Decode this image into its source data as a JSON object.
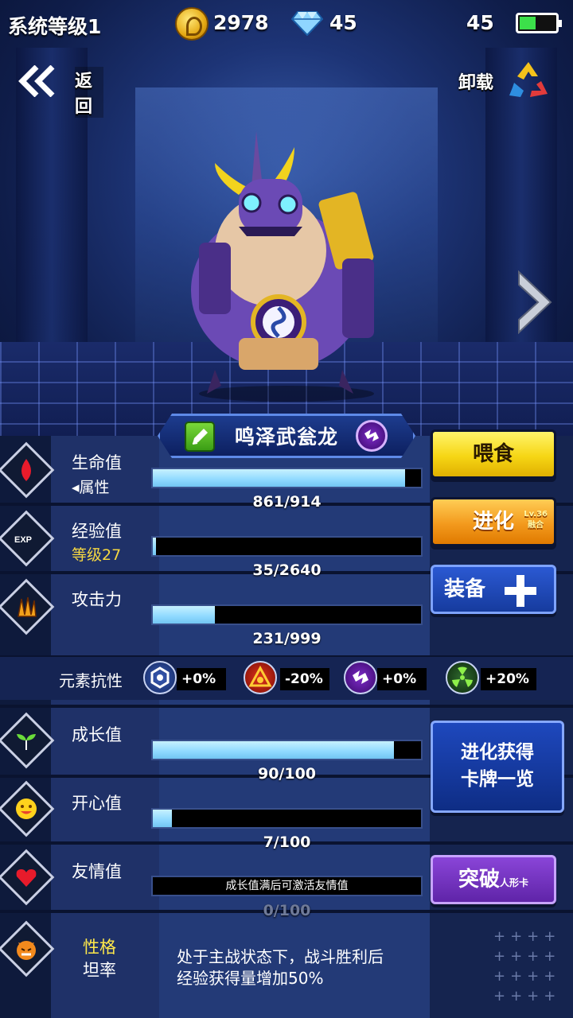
{
  "status_bar": {
    "system_level": "系统等级1",
    "coins": "2978",
    "gems": "45",
    "battery_text": "45",
    "battery_level": 0.45
  },
  "nav": {
    "back_label": "返回",
    "unload_label": "卸载"
  },
  "monster": {
    "name": "鸣泽武瓮龙"
  },
  "stats": {
    "hp": {
      "label": "生命值",
      "sub": "◂属性",
      "current": 861,
      "max": 914,
      "text": "861/914"
    },
    "exp": {
      "label": "经验值",
      "sub": "等级27",
      "current": 35,
      "max": 2640,
      "text": "35/2640"
    },
    "attack": {
      "label": "攻击力",
      "current": 231,
      "max": 999,
      "text": "231/999"
    },
    "growth": {
      "label": "成长值",
      "current": 90,
      "max": 100,
      "text": "90/100"
    },
    "happiness": {
      "label": "开心值",
      "current": 7,
      "max": 100,
      "text": "7/100"
    },
    "friendship": {
      "label": "友情值",
      "current": 0,
      "max": 100,
      "text": "0/100",
      "lock_message": "成长值满后可激活友情值"
    }
  },
  "resistance": {
    "label": "元素抗性",
    "items": [
      {
        "icon": "hex-ring-icon",
        "value": "+0%"
      },
      {
        "icon": "fire-triangle-icon",
        "value": "-20%"
      },
      {
        "icon": "lightning-icon",
        "value": "+0%"
      },
      {
        "icon": "radiation-icon",
        "value": "+20%"
      }
    ]
  },
  "buttons": {
    "feed": "喂食",
    "evolve": "进化",
    "evolve_tag_1": "Lv.36",
    "evolve_tag_2": "融合",
    "equip": "装备",
    "evolve_cards_1": "进化获得",
    "evolve_cards_2": "卡牌一览",
    "breakthrough": "突破",
    "breakthrough_tag": "人形卡"
  },
  "personality": {
    "label": "性格",
    "value": "坦率",
    "description_1": "处于主战状态下，战斗胜利后",
    "description_2": "经验获得量增加50%"
  },
  "colors": {
    "bar_fill": "#8fd9ff",
    "feed_button": "#f6d615",
    "evolve_button": "#f39a1d",
    "equip_button": "#163b9e",
    "break_button": "#5f24a8",
    "personality_label": "#ffe94a"
  }
}
